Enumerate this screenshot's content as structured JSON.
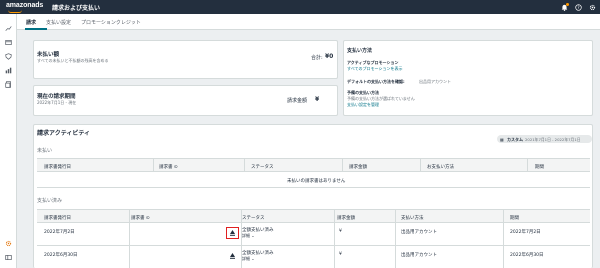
{
  "header": {
    "logo": "amazonads",
    "title": "請求および支払い",
    "icons": [
      "bell-icon",
      "help-icon",
      "gear-icon"
    ],
    "accent": "#ff9900"
  },
  "tabs": [
    "請求",
    "支払い設定",
    "プロモーションクレジット"
  ],
  "sidebar_icons": [
    "trend-icon",
    "campaign-icon",
    "shield-icon",
    "bar-chart-icon",
    "report-icon",
    "gear-icon",
    "dock-icon"
  ],
  "unpaid": {
    "title": "未払い額",
    "subtitle": "すべての未払いと不払額の残高を含める",
    "total_label": "合計:",
    "total_value": "¥0"
  },
  "period": {
    "title": "現在の請求期間",
    "subtitle": "2022年7月1日 - 現在",
    "amount_label": "請求金額",
    "amount_value": "¥"
  },
  "payment": {
    "title": "支払い方法",
    "active_promo_label": "アクティブなプロモーション",
    "active_promo_link": "すべてのプロモーションを表示",
    "default_label": "デフォルトの支払い方法を確認:",
    "default_value": "出品用アカウント",
    "backup_label": "予備の支払い方法",
    "backup_value": "予備の支払い方法が選ばれていません",
    "backup_link": "支払い設定を管理"
  },
  "activity": {
    "title": "請求アクティビティ",
    "date_range_label": "カスタム",
    "date_range": "2021年7月1日 - 2022年7月1日",
    "unpaid_section": "未払い",
    "unpaid_columns": [
      "請求書発行日",
      "請求書 ⊙",
      "ステータス",
      "請求金額",
      "お支払い方法",
      "期間"
    ],
    "unpaid_empty": "未払いの請求書はありません",
    "paid_section": "支払い済み",
    "paid_columns": [
      "請求書発行日",
      "請求書 ⊙",
      "ステータス",
      "請求金額",
      "支払い方法",
      "期間"
    ],
    "rows": [
      {
        "date": "2022年7月2日",
        "status": "全額支払い済み",
        "detail": "詳細 ⌄",
        "amount": "¥",
        "method": "出品用アカウント",
        "period": "2022年7月2日"
      },
      {
        "date": "2022年6月30日",
        "status": "全額支払い済み",
        "detail": "詳細 ⌄",
        "amount": "¥",
        "method": "出品用アカウント",
        "period": "2022年6月30日"
      }
    ]
  }
}
